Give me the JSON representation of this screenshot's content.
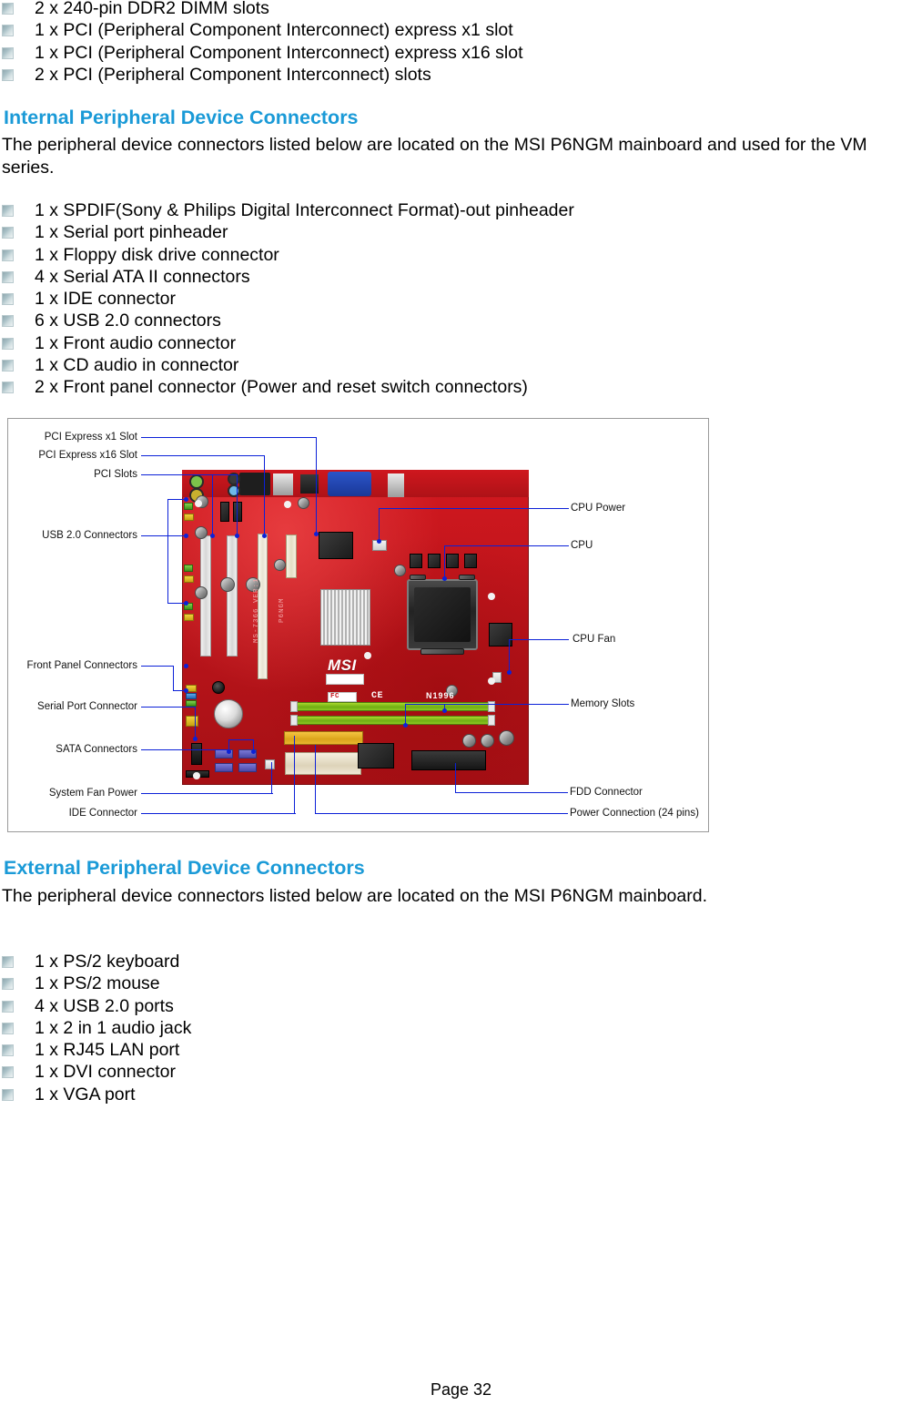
{
  "document": {
    "page_label": "Page 32"
  },
  "slots_list": {
    "items": [
      "2 x 240-pin DDR2 DIMM slots",
      "1 x PCI (Peripheral Component Interconnect) express x1 slot",
      "1 x PCI (Peripheral Component Interconnect) express x16 slot",
      "2 x PCI (Peripheral Component Interconnect) slots"
    ]
  },
  "internal_section": {
    "heading": "Internal Peripheral Device Connectors",
    "paragraph_line1": "The peripheral device connectors listed below are located on the MSI P6NGM mainboard and used for the VM",
    "paragraph_line2": "series.",
    "items": [
      "1 x SPDIF(Sony & Philips Digital Interconnect Format)-out pinheader",
      "1 x Serial port pinheader",
      "1 x Floppy disk drive connector",
      "4 x Serial ATA II connectors",
      "1 x IDE connector",
      "6 x USB 2.0 connectors",
      "1 x Front audio connector",
      "1 x CD audio in connector",
      "2 x Front panel connector (Power and reset switch connectors)"
    ]
  },
  "diagram": {
    "board_silkscreen": {
      "model_vert": "MS-7366  VER:1",
      "name_vert": "P6NGM",
      "brand": "MSI",
      "cert": "N1996",
      "fcc": "FC",
      "ce": "CE"
    },
    "left_labels": [
      "PCI Express x1 Slot",
      "PCI Express x16 Slot",
      "PCI Slots",
      "USB 2.0 Connectors",
      "Front Panel Connectors",
      "Serial Port Connector",
      "SATA Connectors",
      "System Fan Power",
      "IDE Connector"
    ],
    "right_labels": [
      "CPU Power",
      "CPU",
      "CPU Fan",
      "Memory Slots",
      "FDD Connector",
      "Power Connection (24 pins)"
    ]
  },
  "external_section": {
    "heading": "External Peripheral Device Connectors",
    "paragraph": "The peripheral device connectors listed below are located on the MSI P6NGM mainboard.",
    "items": [
      "1 x PS/2 keyboard",
      "1 x PS/2 mouse",
      "4 x USB 2.0 ports",
      "1 x 2 in 1 audio jack",
      "1 x RJ45 LAN port",
      "1 x DVI connector",
      "1 x VGA port"
    ]
  },
  "colors": {
    "heading_blue": "#1a9ad7",
    "callout_blue": "#0b21d8",
    "board_red": "#c3141b",
    "dimm_green": "#8cc722",
    "ide_yellow": "#e8b62f"
  }
}
